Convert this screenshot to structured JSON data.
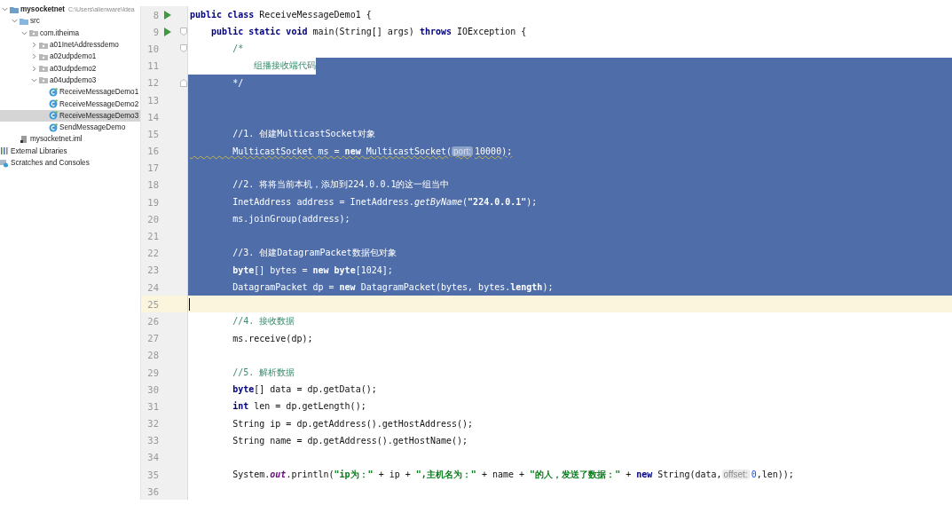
{
  "project_tree": [
    {
      "label": "mysocketnet",
      "path": "C:\\Users\\alienware\\Idea",
      "kind": "project",
      "expanded": true,
      "selected": false,
      "children": [
        {
          "label": "src",
          "kind": "folder",
          "expanded": true,
          "selected": false,
          "children": [
            {
              "label": "com.itheima",
              "kind": "package",
              "expanded": true,
              "selected": false,
              "children": [
                {
                  "label": "a01InetAddressdemo",
                  "kind": "package",
                  "expanded": false,
                  "selected": false
                },
                {
                  "label": "a02udpdemo1",
                  "kind": "package",
                  "expanded": false,
                  "selected": false
                },
                {
                  "label": "a03udpdemo2",
                  "kind": "package",
                  "expanded": false,
                  "selected": false
                },
                {
                  "label": "a04udpdemo3",
                  "kind": "package",
                  "expanded": true,
                  "selected": false,
                  "children": [
                    {
                      "label": "ReceiveMessageDemo1",
                      "kind": "class",
                      "selected": false
                    },
                    {
                      "label": "ReceiveMessageDemo2",
                      "kind": "class",
                      "selected": false
                    },
                    {
                      "label": "ReceiveMessageDemo3",
                      "kind": "class",
                      "selected": true
                    },
                    {
                      "label": "SendMessageDemo",
                      "kind": "class",
                      "selected": false
                    }
                  ]
                }
              ]
            }
          ]
        },
        {
          "label": "mysocketnet.iml",
          "kind": "module-file",
          "selected": false
        }
      ]
    },
    {
      "label": "External Libraries",
      "kind": "library",
      "selected": false
    },
    {
      "label": "Scratches and Consoles",
      "kind": "scratches",
      "selected": false
    }
  ],
  "editor": {
    "lines": [
      {
        "number": "8",
        "run": true,
        "selected": false,
        "tokens": [
          {
            "kind": "keyword",
            "text": "public class "
          },
          {
            "kind": "plain",
            "text": "ReceiveMessageDemo1 {"
          }
        ]
      },
      {
        "number": "9",
        "run": true,
        "fold_start": true,
        "selected": false,
        "tokens": [
          {
            "kind": "keyword",
            "text": "    public static void "
          },
          {
            "kind": "plain",
            "text": "main(String[] args) "
          },
          {
            "kind": "keyword",
            "text": "throws "
          },
          {
            "kind": "plain",
            "text": "IOException {"
          }
        ]
      },
      {
        "number": "10",
        "fold_start": true,
        "selected": false,
        "tokens": [
          {
            "kind": "comment",
            "text": "        /*"
          }
        ]
      },
      {
        "number": "11",
        "selected": false,
        "selected_after_text": true,
        "tokens": [
          {
            "kind": "comment",
            "text": "            组播接收端代码"
          }
        ]
      },
      {
        "number": "12",
        "fold_end": true,
        "selected": true,
        "tokens": [
          {
            "kind": "comment",
            "text": "        */"
          }
        ]
      },
      {
        "number": "13",
        "selected": true
      },
      {
        "number": "14",
        "selected": true
      },
      {
        "number": "15",
        "selected": true,
        "tokens": [
          {
            "kind": "comment",
            "text": "        //1. 创建MulticastSocket对象"
          }
        ]
      },
      {
        "number": "16",
        "selected": true,
        "underlined": true,
        "tokens": [
          {
            "kind": "plain",
            "text": "        MulticastSocket ms = "
          },
          {
            "kind": "keyword",
            "text": "new "
          },
          {
            "kind": "plain",
            "text": "MulticastSocket("
          },
          {
            "kind": "hint",
            "text": "port:"
          },
          {
            "kind": "number",
            "text": "10000"
          },
          {
            "kind": "plain",
            "text": ");"
          }
        ]
      },
      {
        "number": "17",
        "selected": true
      },
      {
        "number": "18",
        "selected": true,
        "tokens": [
          {
            "kind": "comment",
            "text": "        //2. 将将当前本机，添加到224.0.0.1的这一组当中"
          }
        ]
      },
      {
        "number": "19",
        "selected": true,
        "tokens": [
          {
            "kind": "plain",
            "text": "        InetAddress address = InetAddress."
          },
          {
            "kind": "method",
            "text": "getByName"
          },
          {
            "kind": "plain",
            "text": "("
          },
          {
            "kind": "string",
            "text": "\"224.0.0.1\""
          },
          {
            "kind": "plain",
            "text": ");"
          }
        ]
      },
      {
        "number": "20",
        "selected": true,
        "tokens": [
          {
            "kind": "plain",
            "text": "        ms.joinGroup(address);"
          }
        ]
      },
      {
        "number": "21",
        "selected": true
      },
      {
        "number": "22",
        "selected": true,
        "tokens": [
          {
            "kind": "comment",
            "text": "        //3. 创建DatagramPacket数据包对象"
          }
        ]
      },
      {
        "number": "23",
        "selected": true,
        "tokens": [
          {
            "kind": "keyword",
            "text": "        byte"
          },
          {
            "kind": "plain",
            "text": "[] bytes = "
          },
          {
            "kind": "keyword",
            "text": "new byte"
          },
          {
            "kind": "plain",
            "text": "["
          },
          {
            "kind": "number",
            "text": "1024"
          },
          {
            "kind": "plain",
            "text": "];"
          }
        ]
      },
      {
        "number": "24",
        "selected": true,
        "tokens": [
          {
            "kind": "plain",
            "text": "        DatagramPacket dp = "
          },
          {
            "kind": "keyword",
            "text": "new "
          },
          {
            "kind": "plain",
            "text": "DatagramPacket(bytes, bytes."
          },
          {
            "kind": "field",
            "text": "length"
          },
          {
            "kind": "plain",
            "text": ");"
          }
        ]
      },
      {
        "number": "25",
        "selected": false,
        "current": true
      },
      {
        "number": "26",
        "selected": false,
        "tokens": [
          {
            "kind": "comment",
            "text": "        //4. 接收数据"
          }
        ]
      },
      {
        "number": "27",
        "selected": false,
        "tokens": [
          {
            "kind": "plain",
            "text": "        ms.receive(dp);"
          }
        ]
      },
      {
        "number": "28",
        "selected": false
      },
      {
        "number": "29",
        "selected": false,
        "tokens": [
          {
            "kind": "comment",
            "text": "        //5. 解析数据"
          }
        ]
      },
      {
        "number": "30",
        "selected": false,
        "tokens": [
          {
            "kind": "keyword",
            "text": "        byte"
          },
          {
            "kind": "plain",
            "text": "[] data = dp.getData();"
          }
        ]
      },
      {
        "number": "31",
        "selected": false,
        "tokens": [
          {
            "kind": "keyword",
            "text": "        int "
          },
          {
            "kind": "plain",
            "text": "len = dp.getLength();"
          }
        ]
      },
      {
        "number": "32",
        "selected": false,
        "tokens": [
          {
            "kind": "plain",
            "text": "        String ip = dp.getAddress().getHostAddress();"
          }
        ]
      },
      {
        "number": "33",
        "selected": false,
        "tokens": [
          {
            "kind": "plain",
            "text": "        String name = dp.getAddress().getHostName();"
          }
        ]
      },
      {
        "number": "34",
        "selected": false
      },
      {
        "number": "35",
        "selected": false,
        "tokens": [
          {
            "kind": "plain",
            "text": "        System."
          },
          {
            "kind": "static-field",
            "text": "out"
          },
          {
            "kind": "plain",
            "text": ".println("
          },
          {
            "kind": "string",
            "text": "\"ip为：\""
          },
          {
            "kind": "plain",
            "text": " + ip + "
          },
          {
            "kind": "string",
            "text": "\",主机名为：\""
          },
          {
            "kind": "plain",
            "text": " + name + "
          },
          {
            "kind": "string",
            "text": "\"的人，发送了数据：\""
          },
          {
            "kind": "plain",
            "text": " + "
          },
          {
            "kind": "keyword",
            "text": "new "
          },
          {
            "kind": "plain",
            "text": "String(data,"
          },
          {
            "kind": "hint",
            "text": "offset:"
          },
          {
            "kind": "number",
            "text": "0"
          },
          {
            "kind": "plain",
            "text": ",len));"
          }
        ]
      },
      {
        "number": "36",
        "selected": false
      }
    ]
  }
}
